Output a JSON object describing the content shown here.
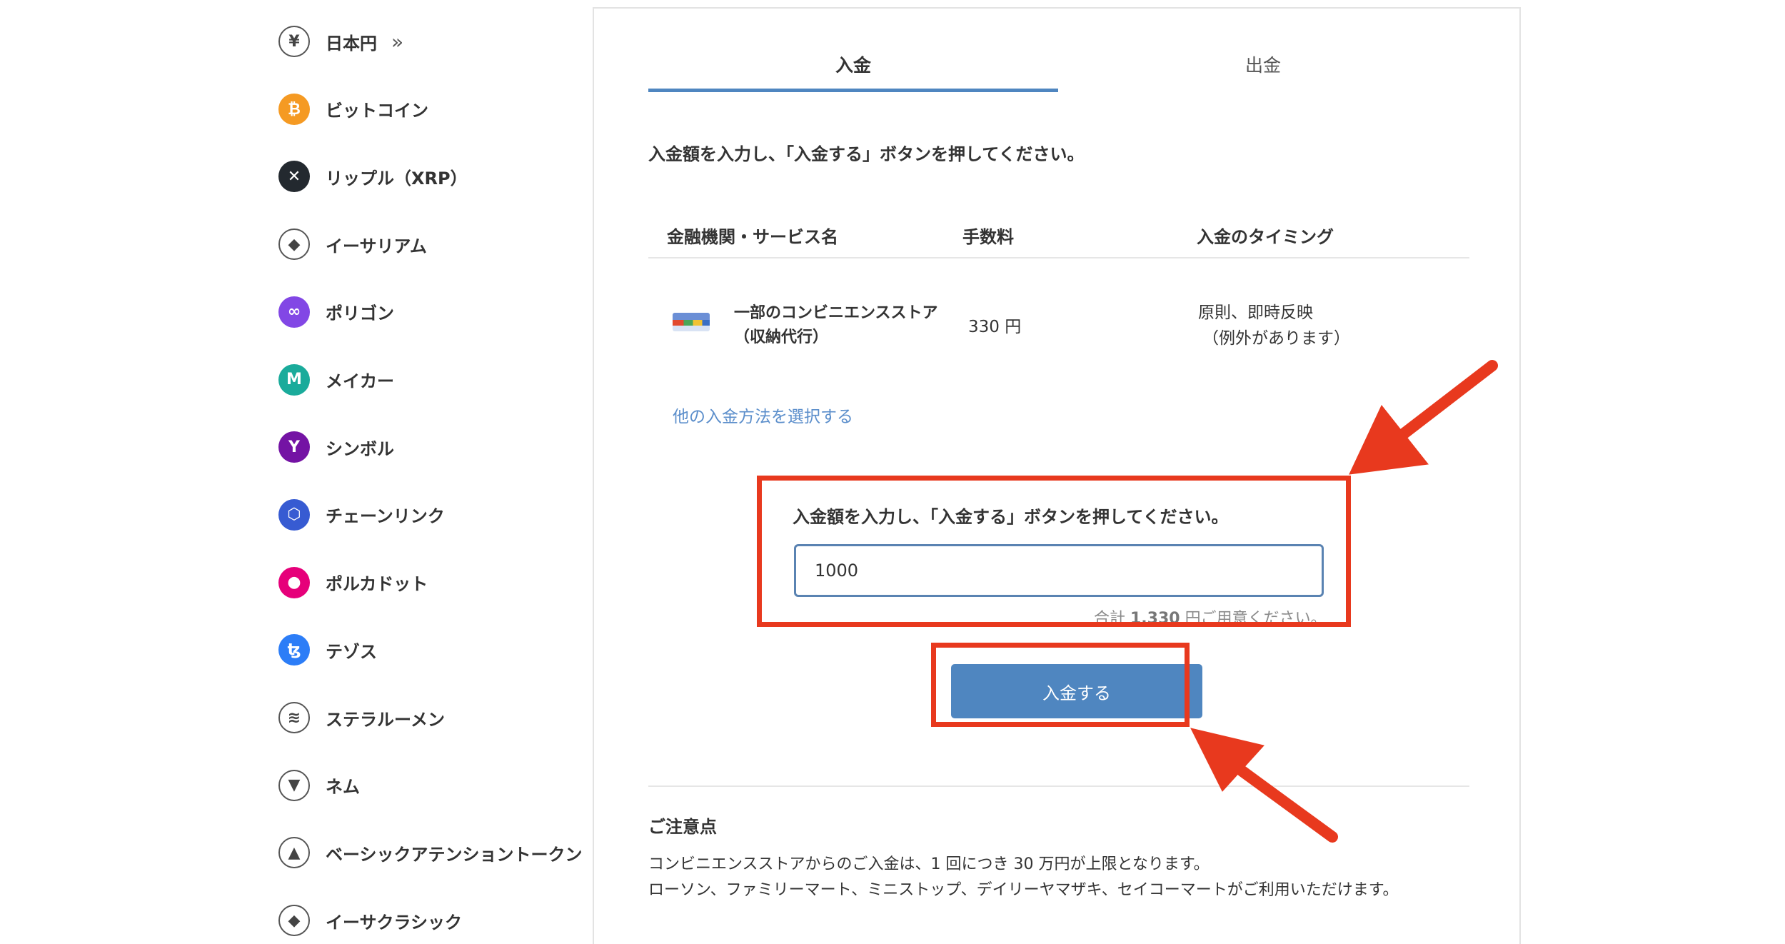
{
  "sidebar": {
    "items": [
      {
        "label": "日本円",
        "icon": "yen-icon",
        "color": "#ffffff",
        "glyph": "¥",
        "chevron": "»"
      },
      {
        "label": "ビットコイン",
        "icon": "bitcoin-icon",
        "color": "#f59a23",
        "glyph": "₿"
      },
      {
        "label": "リップル（XRP）",
        "icon": "xrp-icon",
        "color": "#23292f",
        "glyph": "✕"
      },
      {
        "label": "イーサリアム",
        "icon": "ethereum-icon",
        "color": "#ffffff",
        "glyph": "◆"
      },
      {
        "label": "ポリゴン",
        "icon": "polygon-icon",
        "color": "#8247e5",
        "glyph": "∞"
      },
      {
        "label": "メイカー",
        "icon": "maker-icon",
        "color": "#1aab9b",
        "glyph": "M"
      },
      {
        "label": "シンボル",
        "icon": "symbol-icon",
        "color": "#7413a4",
        "glyph": "Y"
      },
      {
        "label": "チェーンリンク",
        "icon": "chainlink-icon",
        "color": "#375bd2",
        "glyph": "⬡"
      },
      {
        "label": "ポルカドット",
        "icon": "polkadot-icon",
        "color": "#e6007a",
        "glyph": "●"
      },
      {
        "label": "テゾス",
        "icon": "tezos-icon",
        "color": "#2c7df7",
        "glyph": "ꜩ"
      },
      {
        "label": "ステラルーメン",
        "icon": "stellar-icon",
        "color": "#ffffff",
        "glyph": "≋"
      },
      {
        "label": "ネム",
        "icon": "nem-icon",
        "color": "#ffffff",
        "glyph": "▼"
      },
      {
        "label": "ベーシックアテンショントークン",
        "icon": "bat-icon",
        "color": "#ffffff",
        "glyph": "▲"
      },
      {
        "label": "イーサクラシック",
        "icon": "ethereum-classic-icon",
        "color": "#ffffff",
        "glyph": "◆"
      }
    ]
  },
  "tabs": {
    "deposit": "入金",
    "withdraw": "出金"
  },
  "instruction": "入金額を入力し、「入金する」ボタンを押してください。",
  "table": {
    "headers": {
      "name": "金融機関・サービス名",
      "fee": "手数料",
      "timing": "入金のタイミング"
    },
    "row": {
      "name": "一部のコンビニエンスストア（収納代行）",
      "fee": "330 円",
      "timing_line1": "原則、即時反映",
      "timing_line2": "（例外があります）"
    }
  },
  "other_method_link": "他の入金方法を選択する",
  "amount": {
    "label": "入金額を入力し、「入金する」ボタンを押してください。",
    "value": "1000",
    "total_prefix": "合計 ",
    "total_value": "1,330",
    "total_suffix": " 円ご用意ください。"
  },
  "deposit_button": "入金する",
  "notes": {
    "title": "ご注意点",
    "line1": "コンビニエンスストアからのご入金は、1 回につき 30 万円が上限となります。",
    "line2": "ローソン、ファミリーマート、ミニストップ、デイリーヤマザキ、セイコーマートがご利用いただけます。"
  },
  "colors": {
    "accent": "#4f86c0",
    "annotation_red": "#e8391e",
    "link": "#5b8ecb"
  }
}
